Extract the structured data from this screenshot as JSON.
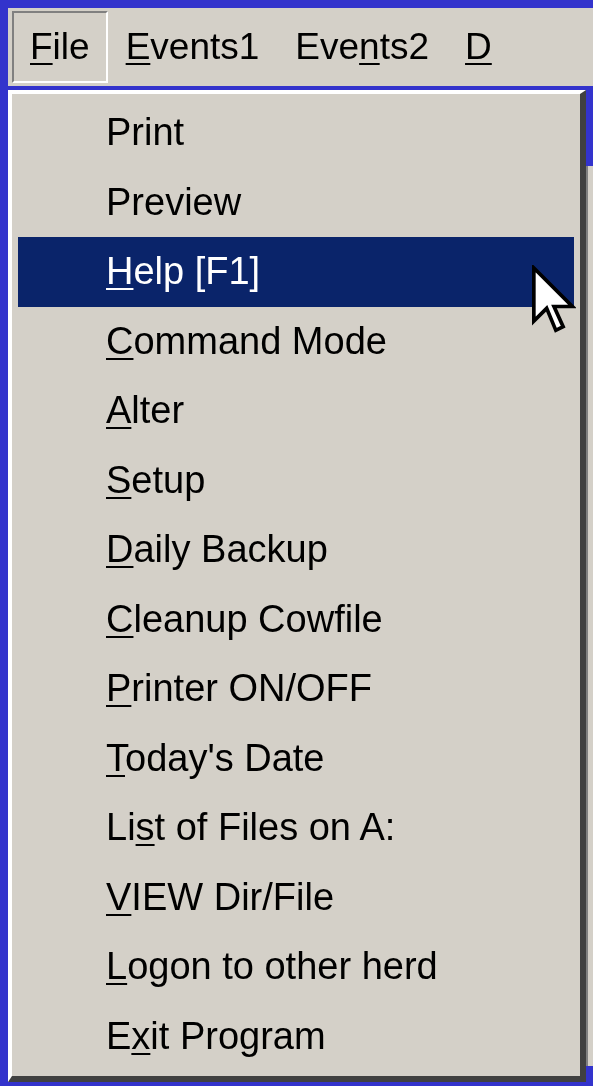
{
  "menu_bar": [
    {
      "key": "F",
      "post": "ile",
      "selected": true
    },
    {
      "key": "E",
      "post": "vents1",
      "selected": false
    },
    {
      "pre": "Eve",
      "key": "n",
      "post": "ts2",
      "selected": false
    },
    {
      "key": "D",
      "selected": false
    }
  ],
  "file_menu": {
    "items": [
      {
        "pre": "Print",
        "selected": false
      },
      {
        "pre": "Preview",
        "selected": false
      },
      {
        "key": "H",
        "post": "elp [F1]",
        "selected": true
      },
      {
        "key": "C",
        "post": "ommand Mode",
        "selected": false
      },
      {
        "key": "A",
        "post": "lter",
        "selected": false
      },
      {
        "key": "S",
        "post": "etup",
        "selected": false
      },
      {
        "key": "D",
        "post": "aily Backup",
        "selected": false
      },
      {
        "key": "C",
        "post": "leanup Cowfile",
        "selected": false
      },
      {
        "key": "P",
        "post": "rinter ON/OFF",
        "selected": false
      },
      {
        "key": "T",
        "post": "oday's Date",
        "selected": false
      },
      {
        "pre": "Li",
        "key": "s",
        "post": "t of Files on A:",
        "selected": false
      },
      {
        "key": "V",
        "post": "IEW Dir/File",
        "selected": false
      },
      {
        "key": "L",
        "post": "ogon to other herd",
        "selected": false
      },
      {
        "pre": "E",
        "key": "x",
        "post": "it Program",
        "selected": false
      }
    ]
  }
}
